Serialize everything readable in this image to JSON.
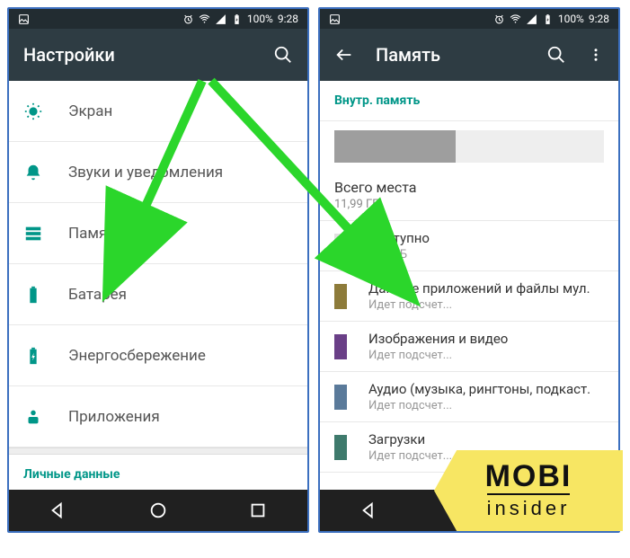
{
  "status": {
    "battery": "100%",
    "time": "9:28"
  },
  "left": {
    "title": "Настройки",
    "items": [
      {
        "icon": "brightness",
        "label": "Экран"
      },
      {
        "icon": "bell",
        "label": "Звуки и уведомления"
      },
      {
        "icon": "storage",
        "label": "Память"
      },
      {
        "icon": "battery",
        "label": "Батарея"
      },
      {
        "icon": "energy",
        "label": "Энергосбережение"
      },
      {
        "icon": "apps",
        "label": "Приложения"
      }
    ],
    "personal_header": "Личные данные"
  },
  "right": {
    "title": "Память",
    "section": "Внутр. память",
    "total": {
      "label": "Всего места",
      "value": "11,99 ГБ"
    },
    "bar_fill_percent": 45,
    "rows": [
      {
        "color": "#e0e0e0",
        "label": "Доступно",
        "sub": "6,63 ГБ"
      },
      {
        "color": "#8d7b3a",
        "label": "Данные приложений и файлы мул.",
        "sub": "Идет подсчет..."
      },
      {
        "color": "#6a3f87",
        "label": "Изображения и видео",
        "sub": "Идет подсчет..."
      },
      {
        "color": "#5a7a9a",
        "label": "Аудио (музыка, рингтоны, подкаст.",
        "sub": "Идет подсчет..."
      },
      {
        "color": "#3e7a6c",
        "label": "Загрузки",
        "sub": "Идет подсчет..."
      }
    ]
  },
  "watermark": {
    "line1": "MOBI",
    "line2": "insider"
  }
}
